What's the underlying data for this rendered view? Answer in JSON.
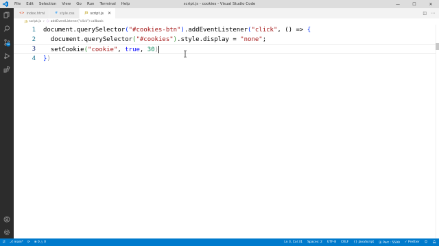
{
  "window": {
    "title": "script.js - cookies - Visual Studio Code",
    "menu": [
      "File",
      "Edit",
      "Selection",
      "View",
      "Go",
      "Run",
      "Terminal",
      "Help"
    ],
    "controls": [
      "—",
      "☐",
      "✕"
    ]
  },
  "tabs": [
    {
      "label": "index.html",
      "icon": "html-file-icon",
      "active": false
    },
    {
      "label": "style.css",
      "icon": "css-file-icon",
      "active": false
    },
    {
      "label": "script.js",
      "icon": "js-file-icon",
      "active": true
    }
  ],
  "breadcrumb": {
    "file": "script.js",
    "symbol": "addEventListener(\"click\") callback"
  },
  "editor": {
    "line_numbers": [
      "1",
      "2",
      "3",
      "4"
    ],
    "lines": {
      "l1": {
        "a": "document.querySelector",
        "b": "(",
        "c": "\"#cookies-btn\"",
        "d": ")",
        "e": ".addEventListener",
        "f": "(",
        "g": "\"click\"",
        "h": ", () => ",
        "i": "{"
      },
      "l2": {
        "a": "  document.querySelector",
        "b": "(",
        "c": "\"#cookies\"",
        "d": ")",
        "e": ".style.display = ",
        "f": "\"none\"",
        "g": ";"
      },
      "l3": {
        "a": "  setCookie",
        "b": "(",
        "c": "\"cookie\"",
        "d": ", ",
        "e": "true",
        "f": ", ",
        "g": "30",
        "h": ")"
      },
      "l4": {
        "a": "}",
        "b": ")"
      }
    }
  },
  "status": {
    "branch": "main*",
    "problems": "0 △ 0",
    "position": "Ln 3, Col 31",
    "spaces": "Spaces: 2",
    "encoding": "UTF-8",
    "eol": "CRLF",
    "language": "{} JavaScript",
    "live_server": "Port : 5500",
    "prettier": "✓ Prettier"
  },
  "colors": {
    "activitybar": "#2c2c2c",
    "statusbar": "#007acc",
    "titlebar": "#dddddd"
  }
}
